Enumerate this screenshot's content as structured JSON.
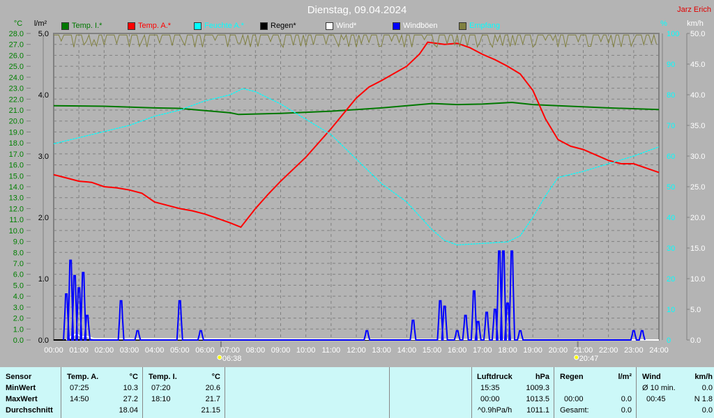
{
  "header": {
    "title": "Dienstag, 09.04.2024",
    "author": "Jarz Erich"
  },
  "legend": [
    {
      "label": "Temp. I.*",
      "color": "#007800",
      "text_color": "#007800"
    },
    {
      "label": "Temp. A.*",
      "color": "#ff0000",
      "text_color": "#ff0000"
    },
    {
      "label": "Feuchte A.*",
      "color": "#00ffff",
      "text_color": "#00ffff"
    },
    {
      "label": "Regen*",
      "color": "#000000",
      "text_color": "#000000"
    },
    {
      "label": "Wind*",
      "color": "#ffffff",
      "text_color": "#ffffff"
    },
    {
      "label": "Windböen",
      "color": "#0000ff",
      "text_color": "#ffffff"
    },
    {
      "label": "Empfang",
      "color": "#808040",
      "text_color": "#00ffff"
    }
  ],
  "chart_data": {
    "type": "line",
    "title": "Dienstag, 09.04.2024",
    "xlabel": "",
    "x_unit": "hour",
    "xlim": [
      0,
      24
    ],
    "x_ticks": [
      "00:00",
      "01:00",
      "02:00",
      "03:00",
      "04:00",
      "05:00",
      "06:00",
      "07:00",
      "08:00",
      "09:00",
      "10:00",
      "11:00",
      "12:00",
      "13:00",
      "14:00",
      "15:00",
      "16:00",
      "17:00",
      "18:00",
      "19:00",
      "20:00",
      "21:00",
      "22:00",
      "23:00",
      "24:00"
    ],
    "axes": {
      "temp": {
        "unit": "°C",
        "range": [
          0,
          28
        ],
        "step": 1,
        "color": "#008000"
      },
      "rain": {
        "unit": "l/m²",
        "range": [
          0,
          5
        ],
        "step": 1,
        "color": "#000000"
      },
      "humidity": {
        "unit": "%",
        "range": [
          0,
          100
        ],
        "step": 10,
        "color": "#00ffff"
      },
      "wind": {
        "unit": "km/h",
        "range": [
          0,
          50
        ],
        "step": 5,
        "color": "#ffffff"
      }
    },
    "grid": true,
    "sun": {
      "sunrise": "06:38",
      "sunset": "20:47"
    },
    "series": [
      {
        "name": "Temp. I.*",
        "axis": "temp",
        "color": "#007800",
        "x": [
          0,
          2,
          4,
          5,
          6,
          7,
          7.33,
          9,
          11,
          13,
          15,
          16,
          17,
          18.17,
          19,
          20,
          22,
          24
        ],
        "y": [
          21.4,
          21.35,
          21.2,
          21.15,
          20.95,
          20.75,
          20.6,
          20.7,
          20.9,
          21.2,
          21.6,
          21.5,
          21.55,
          21.7,
          21.5,
          21.4,
          21.2,
          21.05
        ]
      },
      {
        "name": "Temp. A.*",
        "axis": "temp",
        "color": "#ff0000",
        "x": [
          0,
          0.5,
          1,
          1.5,
          2,
          2.5,
          3,
          3.5,
          4,
          4.5,
          5,
          5.5,
          6,
          6.5,
          7,
          7.42,
          8,
          8.5,
          9,
          10,
          11,
          12,
          12.5,
          13,
          14,
          14.5,
          14.83,
          15.5,
          16,
          16.5,
          17,
          17.5,
          18,
          18.5,
          19,
          19.5,
          20,
          20.5,
          21,
          22,
          22.5,
          23,
          23.5,
          24
        ],
        "y": [
          15.1,
          14.8,
          14.5,
          14.4,
          14.0,
          13.9,
          13.7,
          13.4,
          12.6,
          12.3,
          12.0,
          11.8,
          11.5,
          11.1,
          10.7,
          10.3,
          12.0,
          13.3,
          14.5,
          16.7,
          19.3,
          22.1,
          23.1,
          23.7,
          25.0,
          26.1,
          27.2,
          27.0,
          27.1,
          26.7,
          26.1,
          25.6,
          25.0,
          24.3,
          22.8,
          20.2,
          18.3,
          17.7,
          17.4,
          16.4,
          16.1,
          16.1,
          15.7,
          15.3
        ]
      },
      {
        "name": "Feuchte A.*",
        "axis": "humidity",
        "color": "#00ffff",
        "x": [
          0,
          1,
          2,
          3,
          4,
          5,
          6,
          7,
          7.5,
          8,
          9,
          10,
          11,
          12,
          13,
          14,
          15,
          15.5,
          16,
          17,
          18,
          18.5,
          19,
          19.5,
          20,
          21,
          22,
          23,
          24
        ],
        "y": [
          64,
          66,
          68,
          70,
          73,
          75,
          78,
          80,
          82,
          81,
          77,
          72,
          67,
          59,
          51,
          45,
          36,
          32.5,
          31,
          31.5,
          32,
          34,
          40,
          47,
          53,
          55,
          57.5,
          60,
          63
        ]
      },
      {
        "name": "Regen*",
        "axis": "rain",
        "color": "#000000",
        "x": [
          0,
          24
        ],
        "y": [
          0,
          0
        ]
      },
      {
        "name": "Wind*",
        "axis": "wind",
        "color": "#ffffff",
        "x": [
          0.5,
          0.7,
          0.9,
          1.1,
          1.3,
          1.6,
          24
        ],
        "y": [
          0,
          0.6,
          1.0,
          0.5,
          0.6,
          0.2,
          0
        ]
      },
      {
        "name": "Windböen",
        "axis": "wind",
        "color": "#0000ff",
        "peaks": [
          [
            0.5,
            7.5
          ],
          [
            0.67,
            13.0
          ],
          [
            0.83,
            10.5
          ],
          [
            1.0,
            8.5
          ],
          [
            1.17,
            11.0
          ],
          [
            1.33,
            4.0
          ],
          [
            2.67,
            6.4
          ],
          [
            3.33,
            1.5
          ],
          [
            5.0,
            6.4
          ],
          [
            5.83,
            1.5
          ],
          [
            12.42,
            1.5
          ],
          [
            14.25,
            3.2
          ],
          [
            15.33,
            6.4
          ],
          [
            15.5,
            5.5
          ],
          [
            16.0,
            1.5
          ],
          [
            16.33,
            4.0
          ],
          [
            16.67,
            8.0
          ],
          [
            16.83,
            3.0
          ],
          [
            17.17,
            4.5
          ],
          [
            17.5,
            5.0
          ],
          [
            17.67,
            14.5
          ],
          [
            17.83,
            14.5
          ],
          [
            18.0,
            6.0
          ],
          [
            18.17,
            14.5
          ],
          [
            18.5,
            1.5
          ],
          [
            23.0,
            1.5
          ],
          [
            23.33,
            1.5
          ]
        ]
      },
      {
        "name": "Empfang",
        "axis": "humidity",
        "color": "#808040",
        "level": 98
      }
    ]
  },
  "table": {
    "sensor": {
      "header": "Sensor",
      "rows": [
        "MinWert",
        "MaxWert",
        "Durchschnitt"
      ]
    },
    "temp_a": {
      "header": "Temp. A.",
      "unit": "°C",
      "min_time": "07:25",
      "min": "10.3",
      "max_time": "14:50",
      "max": "27.2",
      "avg": "18.04"
    },
    "temp_i": {
      "header": "Temp. I.",
      "unit": "°C",
      "min_time": "07:20",
      "min": "20.6",
      "max_time": "18:10",
      "max": "21.7",
      "avg": "21.15"
    },
    "pressure": {
      "header": "Luftdruck",
      "unit": "hPa",
      "min_time": "15:35",
      "min": "1009.3",
      "max_time": "00:00",
      "max": "1013.5",
      "trend": "^0.9hPa/h",
      "avg": "1011.1"
    },
    "rain": {
      "header": "Regen",
      "unit": "l/m²",
      "max_time": "00:00",
      "max": "0.0",
      "total_label": "Gesamt:",
      "total": "0.0"
    },
    "wind": {
      "header": "Wind",
      "unit": "km/h",
      "avg_label": "Ø 10 min.",
      "avg": "0.0",
      "max_time": "00:45",
      "max": "N 1.8",
      "extra": "0.0"
    }
  }
}
